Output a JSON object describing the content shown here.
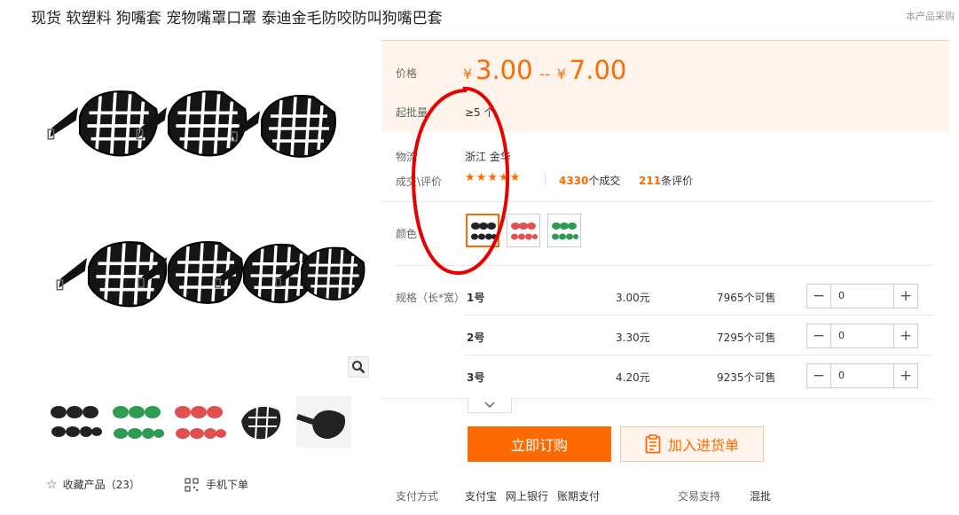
{
  "title": "现货 软塑料 狗嘴套 宠物嘴罩口罩 泰迪金毛防咬防叫狗嘴巴套",
  "procure_note": "本产品采购",
  "price": {
    "label": "价格",
    "currency": "¥",
    "min": "3.00",
    "separator": "--",
    "max": "7.00",
    "moq_label": "起批量",
    "moq_value": "≥5 个"
  },
  "logistics": {
    "label": "物流",
    "value": "浙江 金华"
  },
  "deals": {
    "label": "成交\\评价",
    "stars": 5,
    "count": "4330",
    "count_suffix": "个成交",
    "reviews": "211",
    "reviews_suffix": "条评价"
  },
  "color": {
    "label": "颜色",
    "options": [
      "black",
      "red",
      "green"
    ],
    "selected": 0
  },
  "spec": {
    "label": "规格（长*宽）",
    "rows": [
      {
        "name": "1号",
        "price": "3.00元",
        "stock": "7965个可售",
        "qty": "0"
      },
      {
        "name": "2号",
        "price": "3.30元",
        "stock": "7295个可售",
        "qty": "0"
      },
      {
        "name": "3号",
        "price": "4.20元",
        "stock": "9235个可售",
        "qty": "0"
      }
    ]
  },
  "actions": {
    "buy": "立即订购",
    "add_cart": "加入进货单"
  },
  "gallery": {
    "thumbs": [
      "black-set",
      "green-set",
      "red-set",
      "black-single",
      "black-side"
    ],
    "favorite": "收藏产品（23）",
    "mobile": "手机下单"
  },
  "footer": {
    "payment_label": "支付方式",
    "payments": [
      "支付宝",
      "网上银行",
      "账期支付"
    ],
    "trade_label": "交易支持",
    "trade_value": "混批"
  },
  "colors": {
    "accent": "#ff6a00",
    "price_bg": "#fff5ec",
    "annotation": "#e60000"
  }
}
